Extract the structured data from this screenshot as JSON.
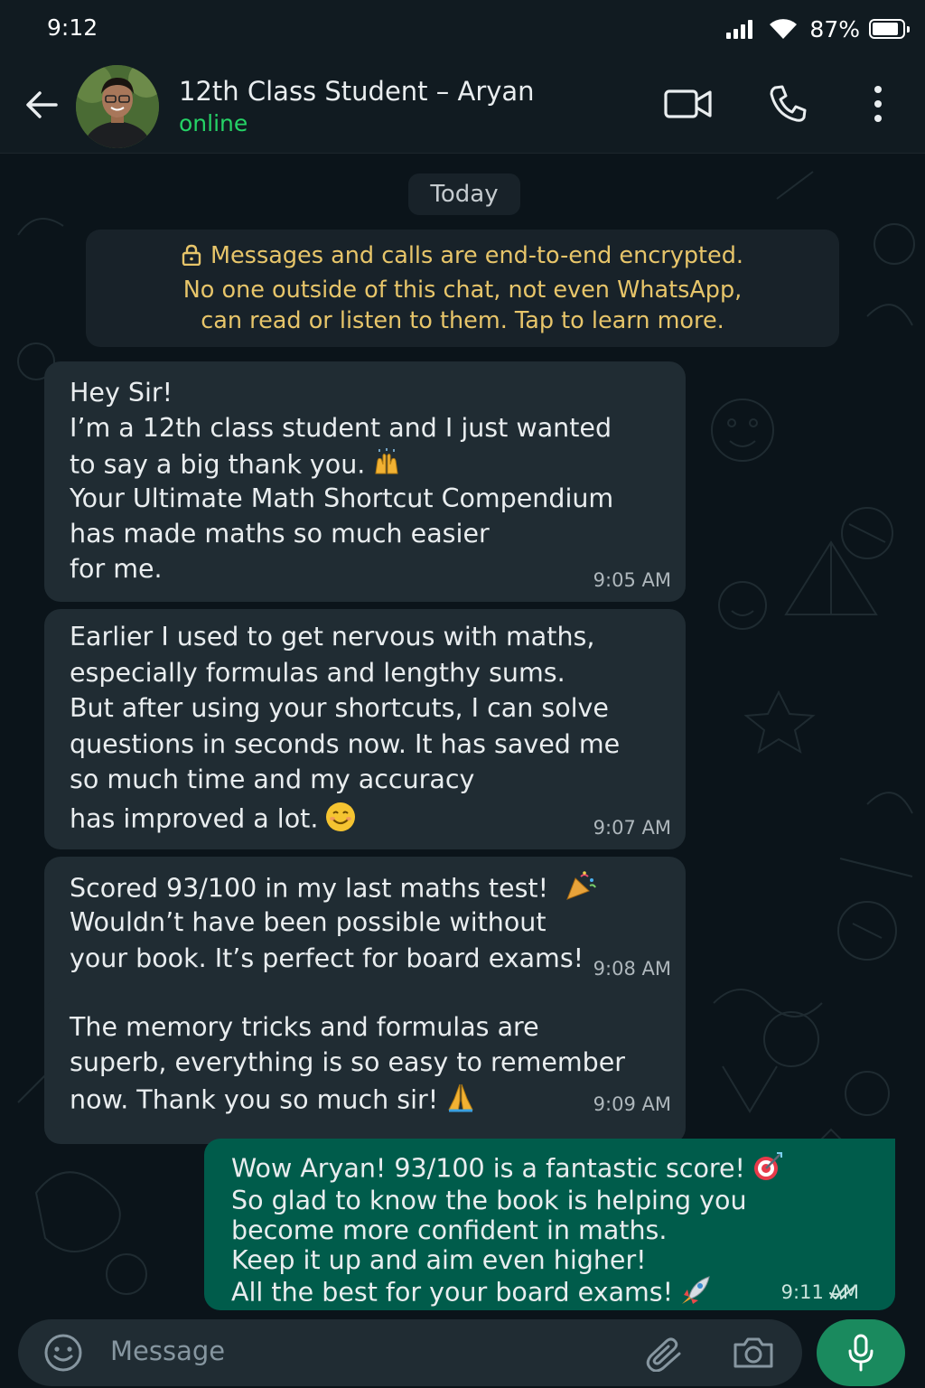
{
  "status_bar": {
    "time": "9:12",
    "battery_pct": "87%"
  },
  "header": {
    "contact_name": "12th Class Student – Aryan",
    "contact_status": "online",
    "icons": [
      "back-arrow-icon",
      "video-call-icon",
      "voice-call-icon",
      "more-options-icon"
    ]
  },
  "chat": {
    "date_chip": "Today",
    "encryption_notice": {
      "lines": [
        "Messages and calls are end-to-end encrypted.",
        "No one outside of this chat, not even WhatsApp,",
        "can read or listen to them. Tap to learn more."
      ]
    },
    "messages": [
      {
        "direction": "incoming",
        "lines": [
          "Hey Sir!",
          "I’m a 12th class student and I just wanted",
          "to say a big thank you.",
          "Your Ultimate Math Shortcut Compendium",
          "has made maths so much easier",
          "for me."
        ],
        "emoji": "🙌",
        "time": "9:05 AM"
      },
      {
        "direction": "incoming",
        "lines": [
          "Earlier I used to get nervous with maths,",
          "especially formulas and lengthy sums.",
          "But after using your shortcuts, I can solve",
          "questions in seconds now. It has saved me",
          "so much time and my accuracy",
          "has improved a lot."
        ],
        "emoji": "😊",
        "time": "9:07 AM"
      },
      {
        "direction": "incoming",
        "lines": [
          "Scored 93/100 in my last maths test!",
          "Wouldn’t have been possible without",
          "your book. It’s perfect for board exams!"
        ],
        "emoji": "🎉",
        "time": "9:08 AM"
      },
      {
        "direction": "incoming",
        "lines": [
          "The memory tricks and formulas are",
          "superb, everything is so easy to remember",
          "now. Thank you so much sir!"
        ],
        "emoji": "🙏",
        "time": "9:09 AM"
      },
      {
        "direction": "outgoing",
        "lines": [
          "Wow Aryan! 93/100 is a fantastic score!",
          "So glad to know the book is helping you",
          "become more confident in maths.",
          "Keep it up and aim even higher!",
          "All the best for your board exams!"
        ],
        "emoji_first_line": "🎯",
        "emoji_last_line": "🚀",
        "time": "9:11 AM",
        "read_receipt": "double-check-icon"
      }
    ]
  },
  "composer": {
    "placeholder": "Message",
    "icons": [
      "emoji-icon",
      "attach-icon",
      "camera-icon",
      "mic-icon"
    ]
  },
  "colors": {
    "background": "#0b141a",
    "header": "#111b21",
    "incoming_bubble": "#202c33",
    "outgoing_bubble": "#005c4b",
    "online_green": "#25d366",
    "notice_text": "#e7c56a",
    "mic_button": "#1a8a5e"
  }
}
